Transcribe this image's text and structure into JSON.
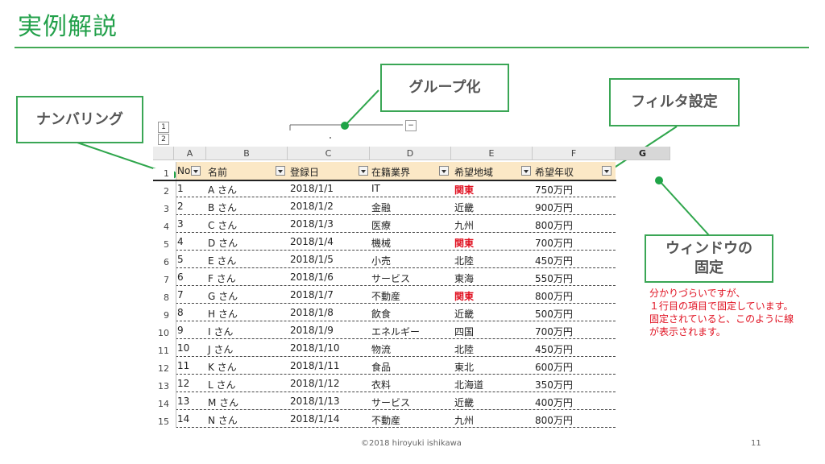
{
  "slide": {
    "title": "実例解説",
    "footer_text": "©2018 hiroyuki ishikawa",
    "page_number": "11"
  },
  "callouts": {
    "numbering": "ナンバリング",
    "grouping": "グループ化",
    "filter": "フィルタ設定",
    "freeze_line1": "ウィンドウの",
    "freeze_line2": "固定"
  },
  "note": {
    "line1": "分かりづらいですが、",
    "line2": "１行目の項目で固定しています。",
    "line3": "固定されていると、このように線",
    "line4": "が表示されます。"
  },
  "sheet": {
    "group_levels": [
      "1",
      "2"
    ],
    "group_collapse": "−",
    "column_letters": [
      "A",
      "B",
      "C",
      "D",
      "E",
      "F",
      "G"
    ],
    "selected_column": "G",
    "headers": [
      "No",
      "名前",
      "登録日",
      "在籍業界",
      "希望地域",
      "希望年収"
    ],
    "row_numbers": [
      "1",
      "2",
      "3",
      "4",
      "5",
      "6",
      "7",
      "8",
      "9",
      "10",
      "11",
      "12",
      "13",
      "14",
      "15"
    ],
    "rows": [
      [
        "1",
        "A さん",
        "2018/1/1",
        "IT",
        "関東",
        "750万円"
      ],
      [
        "2",
        "B さん",
        "2018/1/2",
        "金融",
        "近畿",
        "900万円"
      ],
      [
        "3",
        "C さん",
        "2018/1/3",
        "医療",
        "九州",
        "800万円"
      ],
      [
        "4",
        "D さん",
        "2018/1/4",
        "機械",
        "関東",
        "700万円"
      ],
      [
        "5",
        "E さん",
        "2018/1/5",
        "小売",
        "北陸",
        "450万円"
      ],
      [
        "6",
        "F さん",
        "2018/1/6",
        "サービス",
        "東海",
        "550万円"
      ],
      [
        "7",
        "G さん",
        "2018/1/7",
        "不動産",
        "関東",
        "800万円"
      ],
      [
        "8",
        "H さん",
        "2018/1/8",
        "飲食",
        "近畿",
        "500万円"
      ],
      [
        "9",
        "I さん",
        "2018/1/9",
        "エネルギー",
        "四国",
        "700万円"
      ],
      [
        "10",
        "J さん",
        "2018/1/10",
        "物流",
        "北陸",
        "450万円"
      ],
      [
        "11",
        "K さん",
        "2018/1/11",
        "食品",
        "東北",
        "600万円"
      ],
      [
        "12",
        "L さん",
        "2018/1/12",
        "衣料",
        "北海道",
        "350万円"
      ],
      [
        "13",
        "M さん",
        "2018/1/13",
        "サービス",
        "近畿",
        "400万円"
      ],
      [
        "14",
        "N さん",
        "2018/1/14",
        "不動産",
        "九州",
        "800万円"
      ]
    ],
    "highlight_value": "関東",
    "highlight_color": "#e01020",
    "accent_color": "#22a04a"
  }
}
